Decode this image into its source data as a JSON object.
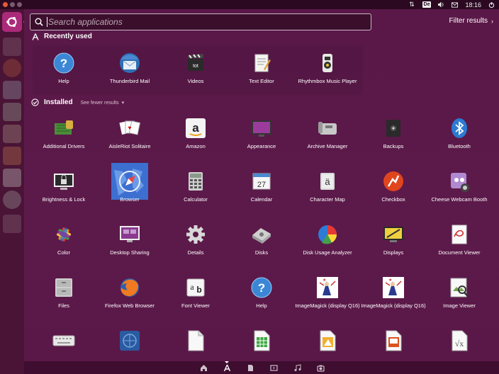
{
  "tray": {
    "keyboard": "De",
    "clock": "18:16"
  },
  "search": {
    "placeholder": "Search applications",
    "filter_label": "Filter results"
  },
  "recent": {
    "title": "Recently used",
    "apps": [
      {
        "label": "Help",
        "icon": "help-icon"
      },
      {
        "label": "Thunderbird Mail",
        "icon": "thunderbird-icon"
      },
      {
        "label": "Videos",
        "icon": "videos-icon"
      },
      {
        "label": "Text Editor",
        "icon": "text-editor-icon"
      },
      {
        "label": "Rhythmbox Music Player",
        "icon": "rhythmbox-icon"
      }
    ]
  },
  "installed": {
    "title": "Installed",
    "toggle": "See fewer results",
    "apps": [
      {
        "label": "Additional Drivers",
        "icon": "additional-drivers-icon"
      },
      {
        "label": "AisleRiot Solitaire",
        "icon": "solitaire-icon"
      },
      {
        "label": "Amazon",
        "icon": "amazon-icon"
      },
      {
        "label": "Appearance",
        "icon": "appearance-icon"
      },
      {
        "label": "Archive Manager",
        "icon": "archive-manager-icon"
      },
      {
        "label": "Backups",
        "icon": "backups-icon"
      },
      {
        "label": "Bluetooth",
        "icon": "bluetooth-icon"
      },
      {
        "label": "Brightness & Lock",
        "icon": "brightness-lock-icon"
      },
      {
        "label": "Browser",
        "icon": "browser-icon"
      },
      {
        "label": "Calculator",
        "icon": "calculator-icon"
      },
      {
        "label": "Calendar",
        "icon": "calendar-icon"
      },
      {
        "label": "Character Map",
        "icon": "character-map-icon"
      },
      {
        "label": "Checkbox",
        "icon": "checkbox-icon"
      },
      {
        "label": "Cheese Webcam Booth",
        "icon": "cheese-icon"
      },
      {
        "label": "Color",
        "icon": "color-icon"
      },
      {
        "label": "Desktop Sharing",
        "icon": "desktop-sharing-icon"
      },
      {
        "label": "Details",
        "icon": "details-icon"
      },
      {
        "label": "Disks",
        "icon": "disks-icon"
      },
      {
        "label": "Disk Usage Analyzer",
        "icon": "disk-usage-icon"
      },
      {
        "label": "Displays",
        "icon": "displays-icon"
      },
      {
        "label": "Document Viewer",
        "icon": "document-viewer-icon"
      },
      {
        "label": "Files",
        "icon": "files-icon"
      },
      {
        "label": "Firefox Web Browser",
        "icon": "firefox-icon"
      },
      {
        "label": "Font Viewer",
        "icon": "font-viewer-icon"
      },
      {
        "label": "Help",
        "icon": "help-icon"
      },
      {
        "label": "ImageMagick (display Q16)",
        "icon": "imagemagick-icon"
      },
      {
        "label": "ImageMagick (display Q16)",
        "icon": "imagemagick-icon"
      },
      {
        "label": "Image Viewer",
        "icon": "image-viewer-icon"
      },
      {
        "label": "",
        "icon": "keyboard-icon"
      },
      {
        "label": "",
        "icon": "landscape-icon"
      },
      {
        "label": "",
        "icon": "libreoffice-icon"
      },
      {
        "label": "",
        "icon": "libreoffice-calc-icon"
      },
      {
        "label": "",
        "icon": "libreoffice-draw-icon"
      },
      {
        "label": "",
        "icon": "libreoffice-impress-icon"
      },
      {
        "label": "",
        "icon": "libreoffice-math-icon"
      }
    ]
  },
  "lenses": [
    "home-lens-icon",
    "applications-lens-icon",
    "files-lens-icon",
    "videos-lens-icon",
    "music-lens-icon",
    "photos-lens-icon"
  ],
  "colors": {
    "dash_bg": "#5a1848",
    "launcher_bg": "#4a1436",
    "home_button": "#ab2a7a",
    "close_button": "#e8583a"
  }
}
